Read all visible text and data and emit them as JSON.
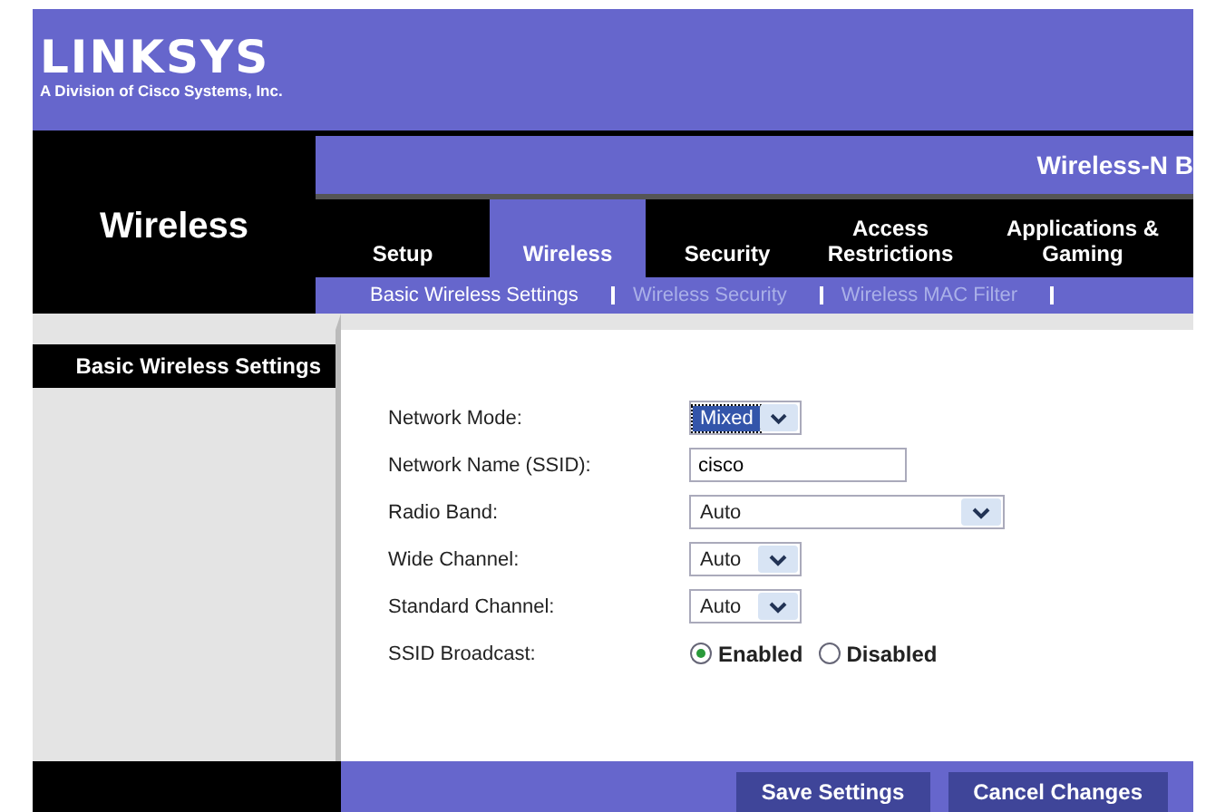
{
  "header": {
    "logo": "LINKSYS",
    "tagline": "A Division of Cisco Systems, Inc."
  },
  "product": "Wireless-N B",
  "section_title": "Wireless",
  "tabs": [
    {
      "label": "Setup",
      "selected": false
    },
    {
      "label": "Wireless",
      "selected": true
    },
    {
      "label": "Security",
      "selected": false
    },
    {
      "label": "Access Restrictions",
      "selected": false
    },
    {
      "label": "Applications & Gaming",
      "selected": false
    }
  ],
  "subtabs": [
    {
      "label": "Basic Wireless Settings",
      "selected": true
    },
    {
      "label": "Wireless Security",
      "selected": false
    },
    {
      "label": "Wireless MAC Filter",
      "selected": false
    }
  ],
  "sidebar_heading": "Basic Wireless Settings",
  "fields": [
    {
      "kind": "select",
      "label": "Network Mode:",
      "value": "Mixed",
      "highlighted": true
    },
    {
      "kind": "text",
      "label": "Network Name (SSID):",
      "value": "cisco"
    },
    {
      "kind": "wideselect",
      "label": "Radio Band:",
      "value": "Auto",
      "highlighted": false
    },
    {
      "kind": "select",
      "label": "Wide Channel:",
      "value": "Auto",
      "highlighted": false
    },
    {
      "kind": "select",
      "label": "Standard Channel:",
      "value": "Auto",
      "highlighted": false
    },
    {
      "kind": "radio",
      "label": "SSID Broadcast:",
      "options": [
        {
          "label": "Enabled",
          "selected": true
        },
        {
          "label": "Disabled",
          "selected": false
        }
      ]
    }
  ],
  "buttons": [
    "Save Settings",
    "Cancel Changes"
  ]
}
